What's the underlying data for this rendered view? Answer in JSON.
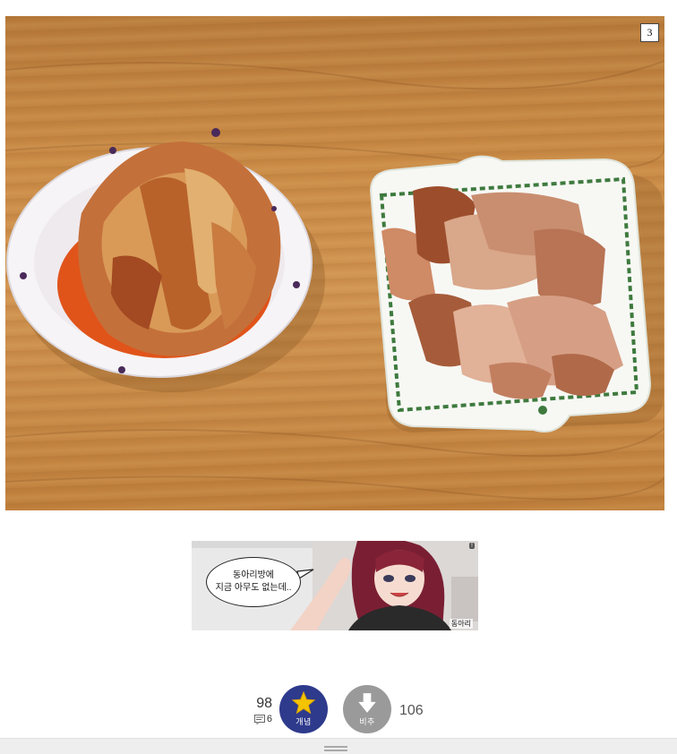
{
  "post": {
    "image_index_badge": "3"
  },
  "ad": {
    "bubble_line1": "동아리방에",
    "bubble_line2": "지금 아무도 없는데..",
    "credit": "동아리"
  },
  "vote": {
    "up_count": "98",
    "comment_count": "6",
    "up_label": "개념",
    "down_label": "비추",
    "down_count": "106"
  },
  "colors": {
    "up_button": "#2e3a8c",
    "down_button": "#9a9a9a",
    "star": "#f5c400"
  }
}
